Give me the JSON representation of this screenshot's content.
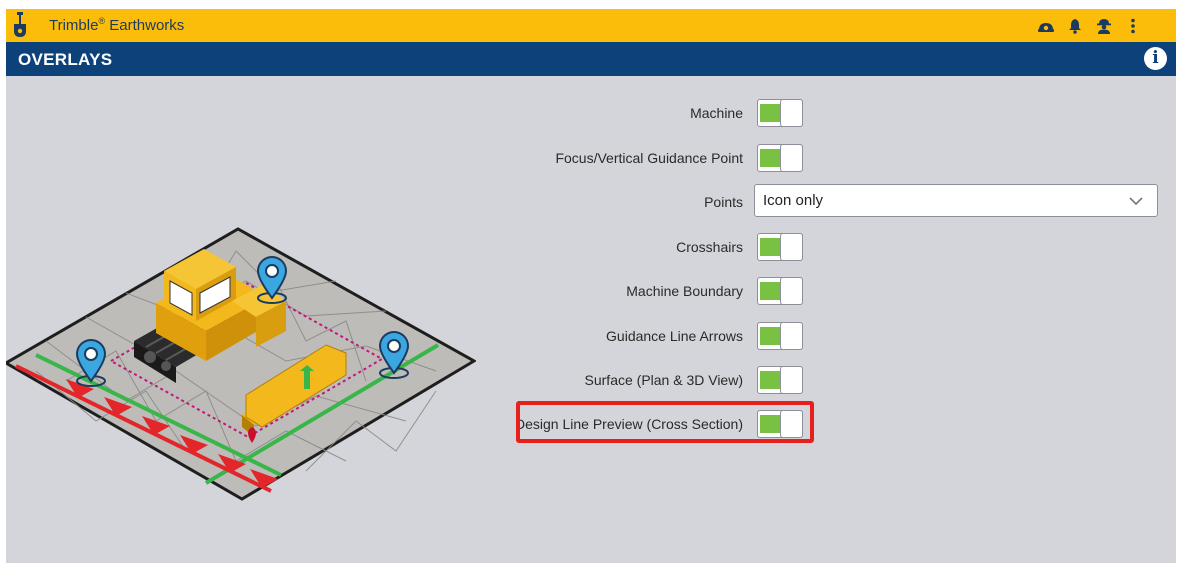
{
  "app": {
    "brand": "Trimble",
    "brand_mark": "®",
    "product": " Earthworks",
    "header_icons": [
      "machine-icon",
      "bell-icon",
      "operator-icon",
      "kebab-menu-icon"
    ]
  },
  "header": {
    "title": "OVERLAYS",
    "info_icon": "info-icon",
    "info_glyph": "i"
  },
  "settings": [
    {
      "label": "Machine",
      "type": "toggle",
      "on": true
    },
    {
      "label": "Focus/Vertical Guidance Point",
      "type": "toggle",
      "on": true
    },
    {
      "label": "Points",
      "type": "select",
      "value": "Icon only"
    },
    {
      "label": "Crosshairs",
      "type": "toggle",
      "on": true
    },
    {
      "label": "Machine Boundary",
      "type": "toggle",
      "on": true
    },
    {
      "label": "Guidance Line Arrows",
      "type": "toggle",
      "on": true
    },
    {
      "label": "Surface (Plan & 3D View)",
      "type": "toggle",
      "on": true
    },
    {
      "label": "Design Line Preview (Cross Section)",
      "type": "toggle",
      "on": true,
      "highlighted": true
    }
  ],
  "colors": {
    "topbar": "#fcbd0a",
    "header": "#0c4279",
    "toggle_on": "#79c142",
    "highlight": "#e8201c",
    "background": "#d4d5da"
  }
}
